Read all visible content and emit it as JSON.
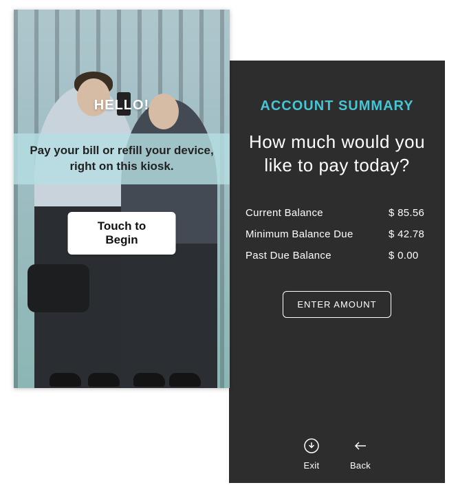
{
  "left_panel": {
    "greeting": "HELLO!",
    "tagline": "Pay your bill or refill your device, right on this kiosk.",
    "begin_label": "Touch to Begin"
  },
  "right_panel": {
    "title": "ACCOUNT SUMMARY",
    "question": "How much would you like to pay today?",
    "balances": [
      {
        "label": "Current Balance",
        "amount": "$ 85.56"
      },
      {
        "label": "Minimum Balance Due",
        "amount": "$ 42.78"
      },
      {
        "label": "Past Due Balance",
        "amount": "$   0.00"
      }
    ],
    "enter_amount_label": "ENTER AMOUNT",
    "footer": {
      "exit_label": "Exit",
      "back_label": "Back"
    }
  },
  "colors": {
    "accent": "#45c5d6",
    "dark_bg": "#2d2d2d"
  }
}
